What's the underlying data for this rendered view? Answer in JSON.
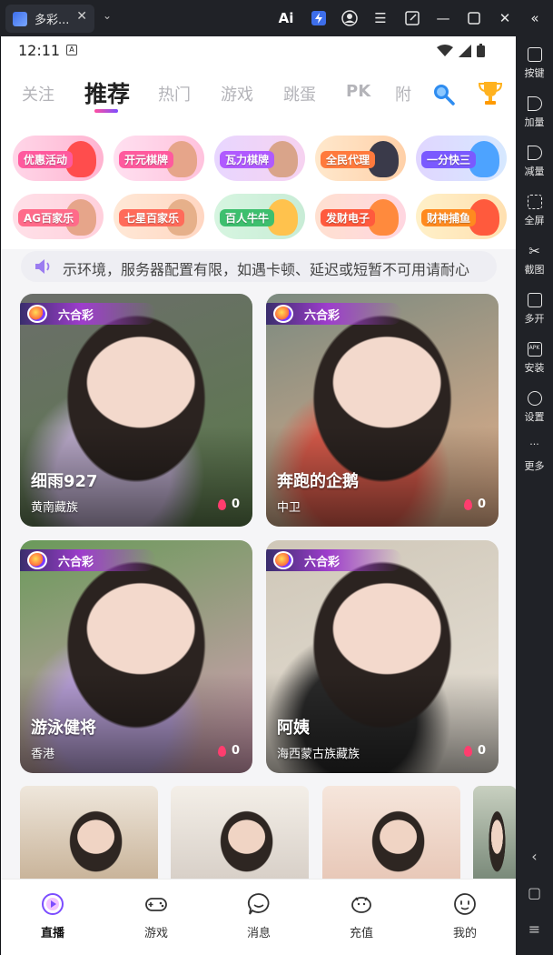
{
  "window": {
    "tab_title": "多彩...",
    "ai_label": "Ai",
    "controls": [
      "minimize",
      "restore",
      "close",
      "collapse"
    ]
  },
  "sidebar": {
    "items": [
      {
        "label": "按键",
        "icon": "keyboard-icon"
      },
      {
        "label": "加量",
        "icon": "volume-up-icon"
      },
      {
        "label": "减量",
        "icon": "volume-down-icon"
      },
      {
        "label": "全屏",
        "icon": "fullscreen-icon"
      },
      {
        "label": "截图",
        "icon": "scissors-icon"
      },
      {
        "label": "多开",
        "icon": "multi-instance-icon"
      },
      {
        "label": "安装",
        "icon": "apk-install-icon"
      },
      {
        "label": "设置",
        "icon": "gear-icon"
      },
      {
        "label": "更多",
        "icon": "more-icon"
      }
    ],
    "bottom": [
      "back-icon",
      "home-icon",
      "menu-icon"
    ]
  },
  "statusbar": {
    "time": "12:11",
    "a_badge": "A"
  },
  "nav": {
    "tabs": [
      "关注",
      "推荐",
      "热门",
      "游戏",
      "跳蛋",
      "PK",
      "附"
    ],
    "active_index": 1
  },
  "banners": [
    {
      "label": "优惠活动",
      "colors": [
        "#ffd6e8",
        "#ffb3d0"
      ],
      "tag": "#ff5a9e",
      "deco": "#ff4d4d"
    },
    {
      "label": "开元棋牌",
      "colors": [
        "#ffe0f0",
        "#ffc2dd"
      ],
      "tag": "#ff5a9e",
      "deco": "#e6a58a"
    },
    {
      "label": "瓦力棋牌",
      "colors": [
        "#e8d6ff",
        "#f6d2f0"
      ],
      "tag": "#b05aff",
      "deco": "#d9a48a"
    },
    {
      "label": "全民代理",
      "colors": [
        "#ffe8cc",
        "#ffd0a8"
      ],
      "tag": "#ff7a3d",
      "deco": "#3a3a4a"
    },
    {
      "label": "一分快三",
      "colors": [
        "#e0d6ff",
        "#d6e8ff"
      ],
      "tag": "#7a5aff",
      "deco": "#4da3ff"
    },
    {
      "label": "AG百家乐",
      "colors": [
        "#ffe0e8",
        "#ffd0dc"
      ],
      "tag": "#ff6b8a",
      "deco": "#e6a58a"
    },
    {
      "label": "七星百家乐",
      "colors": [
        "#ffe8d6",
        "#ffd6c2"
      ],
      "tag": "#ff6b5a",
      "deco": "#e6b08a"
    },
    {
      "label": "百人牛牛",
      "colors": [
        "#d6f5e0",
        "#c8ecd6"
      ],
      "tag": "#3dbf6e",
      "deco": "#ffc24d"
    },
    {
      "label": "发财电子",
      "colors": [
        "#ffe0d0",
        "#ffd6e0"
      ],
      "tag": "#ff5a3d",
      "deco": "#ff8a3d"
    },
    {
      "label": "财神捕鱼",
      "colors": [
        "#fff0c8",
        "#ffe0b0"
      ],
      "tag": "#ff8a1f",
      "deco": "#ff5a3d"
    }
  ],
  "notice": {
    "text": "示环境，服务器配置有限，如遇卡顿、延迟或短暂不可用请耐心"
  },
  "cards": [
    {
      "tag": "六合彩",
      "name": "细雨927",
      "location": "黄南藏族",
      "heat": "0",
      "colors": [
        "#6b6e6a",
        "#b9a9c9",
        "#5b7a4a"
      ]
    },
    {
      "tag": "六合彩",
      "name": "奔跑的企鹅",
      "location": "中卫",
      "heat": "0",
      "colors": [
        "#7b8a80",
        "#d65a4a",
        "#e6b08a"
      ]
    },
    {
      "tag": "六合彩",
      "name": "游泳健将",
      "location": "香港",
      "heat": "0",
      "colors": [
        "#6a9a5a",
        "#b8a0d8",
        "#d8a0b8"
      ]
    },
    {
      "tag": "六合彩",
      "name": "阿姨",
      "location": "海西蒙古族藏族",
      "heat": "0",
      "colors": [
        "#cfc7b8",
        "#2a2a2a",
        "#e8e2d8"
      ]
    }
  ],
  "mini_cards": [
    {
      "colors": [
        "#c9b49a",
        "#efe7dc"
      ]
    },
    {
      "colors": [
        "#d8d0c8",
        "#f4efe8"
      ]
    },
    {
      "colors": [
        "#e8c8b8",
        "#f6e6dc"
      ]
    },
    {
      "colors": [
        "#7a8a7a",
        "#c8d0c0"
      ]
    }
  ],
  "bottom_nav": [
    {
      "label": "直播",
      "icon": "live-play-icon",
      "active": true
    },
    {
      "label": "游戏",
      "icon": "gamepad-icon",
      "active": false
    },
    {
      "label": "消息",
      "icon": "chat-bubble-icon",
      "active": false
    },
    {
      "label": "充值",
      "icon": "piggy-bank-icon",
      "active": false
    },
    {
      "label": "我的",
      "icon": "profile-face-icon",
      "active": false
    }
  ]
}
